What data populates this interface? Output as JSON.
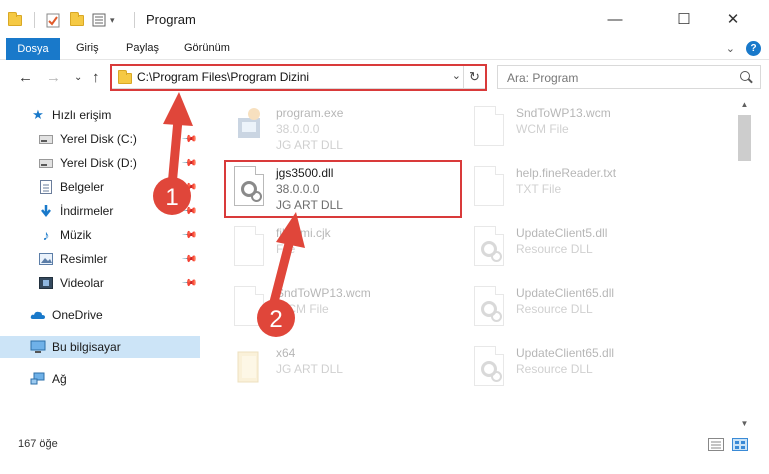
{
  "window": {
    "title": "Program",
    "minimize": "—",
    "maximize": "☐",
    "close": "✕"
  },
  "ribbon": {
    "file_tab": "Dosya",
    "tabs": [
      "Giriş",
      "Paylaş",
      "Görünüm"
    ],
    "expand": "⌄",
    "help": "?"
  },
  "navigation": {
    "back": "←",
    "forward": "→",
    "recent": "⌄",
    "up": "↑",
    "address": "C:\\Program Files\\Program Dizini",
    "refresh": "↻",
    "search_placeholder": "Ara: Program"
  },
  "sidebar": {
    "items": [
      {
        "label": "Hızlı erişim",
        "icon": "star-icon",
        "pinned": false
      },
      {
        "label": "Yerel Disk (C:)",
        "icon": "drive-icon",
        "pinned": true
      },
      {
        "label": "Yerel Disk (D:)",
        "icon": "drive-icon",
        "pinned": true
      },
      {
        "label": "Belgeler",
        "icon": "documents-icon",
        "pinned": true
      },
      {
        "label": "İndirmeler",
        "icon": "downloads-icon",
        "pinned": true
      },
      {
        "label": "Müzik",
        "icon": "music-icon",
        "pinned": true
      },
      {
        "label": "Resimler",
        "icon": "pictures-icon",
        "pinned": true
      },
      {
        "label": "Videolar",
        "icon": "videos-icon",
        "pinned": true
      },
      {
        "label": "OneDrive",
        "icon": "onedrive-icon",
        "pinned": false
      },
      {
        "label": "Bu bilgisayar",
        "icon": "computer-icon",
        "pinned": false
      },
      {
        "label": "Ağ",
        "icon": "network-icon",
        "pinned": false
      }
    ]
  },
  "files": [
    {
      "name": "program.exe",
      "line1": "38.0.0.0",
      "line2": "JG ART DLL",
      "type": "exe",
      "faded": true
    },
    {
      "name": "jgs3500.dll",
      "line1": "38.0.0.0",
      "line2": "JG ART DLL",
      "type": "dll",
      "faded": false
    },
    {
      "name": "fileNmi.cjk",
      "line1": "",
      "line2": "File",
      "type": "doc",
      "faded": true
    },
    {
      "name": "SndToWP13.wcm",
      "line1": "WCM File",
      "line2": "",
      "type": "doc",
      "faded": true
    },
    {
      "name": "x64",
      "line1": "",
      "line2": "JG ART DLL",
      "type": "folder",
      "faded": true
    },
    {
      "name": "SndToWP13.wcm",
      "line1": "WCM File",
      "line2": "",
      "type": "doc",
      "faded": true
    },
    {
      "name": "help.fineReader.txt",
      "line1": "TXT File",
      "line2": "",
      "type": "doc",
      "faded": true
    },
    {
      "name": "UpdateClient5.dll",
      "line1": "Resource DLL",
      "line2": "",
      "type": "dll",
      "faded": true
    },
    {
      "name": "UpdateClient65.dll",
      "line1": "Resource DLL",
      "line2": "",
      "type": "dll",
      "faded": true
    },
    {
      "name": "UpdateClient65.dll",
      "line1": "Resource DLL",
      "line2": "",
      "type": "dll",
      "faded": true
    }
  ],
  "status": {
    "count": "167 öğe"
  },
  "annotations": {
    "step1": "1",
    "step2": "2",
    "color": "#e0463a"
  }
}
